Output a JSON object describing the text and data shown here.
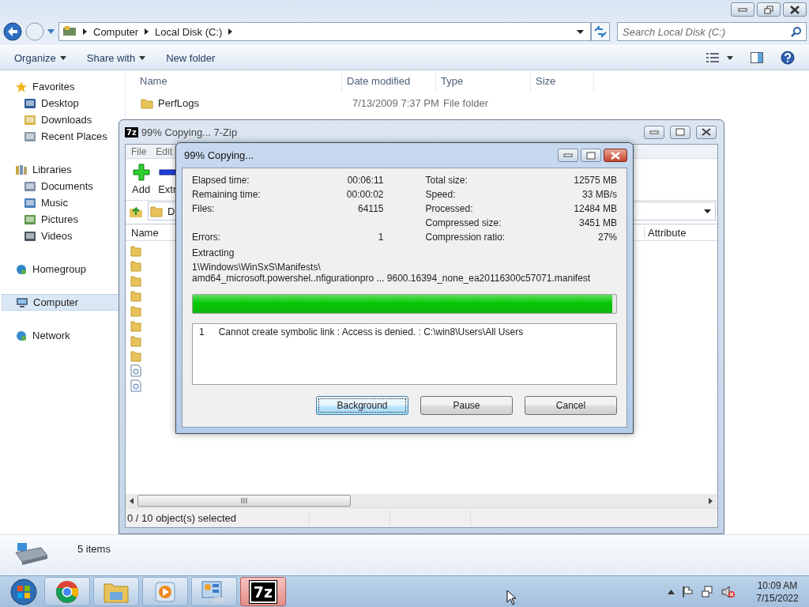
{
  "explorer": {
    "address": [
      "Computer",
      "Local Disk (C:)"
    ],
    "search": {
      "placeholder": "Search Local Disk (C:)"
    },
    "toolbar": [
      {
        "label": "Organize",
        "dropdown": true
      },
      {
        "label": "Share with",
        "dropdown": true
      },
      {
        "label": "New folder",
        "dropdown": false
      }
    ],
    "sidebar": [
      {
        "label": "Favorites",
        "kind": "star",
        "selected": false,
        "children": [
          {
            "label": "Desktop",
            "kind": "desktop",
            "selected": false
          },
          {
            "label": "Downloads",
            "kind": "downloads",
            "selected": false
          },
          {
            "label": "Recent Places",
            "kind": "recent",
            "selected": false
          }
        ]
      },
      {
        "label": "Libraries",
        "kind": "libraries",
        "selected": false,
        "children": [
          {
            "label": "Documents",
            "kind": "documents",
            "selected": false
          },
          {
            "label": "Music",
            "kind": "music",
            "selected": false
          },
          {
            "label": "Pictures",
            "kind": "pictures",
            "selected": false
          },
          {
            "label": "Videos",
            "kind": "videos",
            "selected": false
          }
        ]
      },
      {
        "label": "Homegroup",
        "kind": "homegroup",
        "selected": false
      },
      {
        "label": "Computer",
        "kind": "computer",
        "selected": true
      },
      {
        "label": "Network",
        "kind": "network",
        "selected": false
      }
    ],
    "columns": [
      "Name",
      "Date modified",
      "Type",
      "Size"
    ],
    "rows": [
      {
        "name": "PerfLogs",
        "date": "7/13/2009 7:37 PM",
        "type": "File folder"
      }
    ],
    "details": "5 items"
  },
  "zip_window": {
    "logo": "7z",
    "title": "99% Copying... 7-Zip",
    "menu": [
      "File",
      "Edit"
    ],
    "toolbar": [
      {
        "label": "Add",
        "kind": "add"
      },
      {
        "label": "Extr",
        "kind": "extract"
      }
    ],
    "path": "D",
    "columns": [
      "Name",
      "Attribute"
    ],
    "rows": [
      {
        "kind": "folder"
      },
      {
        "kind": "folder"
      },
      {
        "kind": "folder"
      },
      {
        "kind": "folder"
      },
      {
        "kind": "folder"
      },
      {
        "kind": "folder"
      },
      {
        "kind": "folder"
      },
      {
        "kind": "folder"
      },
      {
        "kind": "file"
      },
      {
        "kind": "file"
      }
    ],
    "status": "0 / 10 object(s) selected"
  },
  "dialog": {
    "title": "99% Copying...",
    "stats": [
      {
        "left": {
          "label": "Elapsed time:",
          "value": "00:06:11"
        },
        "right": {
          "label": "Total size:",
          "value": "12575 MB"
        }
      },
      {
        "left": {
          "label": "Remaining time:",
          "value": "00:00:02"
        },
        "right": {
          "label": "Speed:",
          "value": "33 MB/s"
        }
      },
      {
        "left": {
          "label": "Files:",
          "value": "64115"
        },
        "right": {
          "label": "Processed:",
          "value": "12484 MB"
        }
      },
      {
        "right": {
          "label": "Compressed size:",
          "value": "3451 MB"
        }
      },
      {
        "left": {
          "label": "Errors:",
          "value": "1"
        },
        "right": {
          "label": "Compression ratio:",
          "value": "27%"
        }
      }
    ],
    "operation": "Extracting",
    "path_lines": [
      "1\\Windows\\WinSxS\\Manifests\\",
      "amd64_microsoft.powershel..nfigurationpro ... 9600.16394_none_ea20116300c57071.manifest"
    ],
    "level": 0.99,
    "log": [
      {
        "index": "1",
        "message": "Cannot create symbolic link : Access is denied. : C:\\win8\\Users\\All Users"
      }
    ],
    "buttons": [
      {
        "label": "Background",
        "focused": true
      },
      {
        "label": "Pause",
        "focused": false
      },
      {
        "label": "Cancel",
        "focused": false
      }
    ]
  },
  "taskbar": {
    "apps": [
      {
        "kind": "chrome",
        "selected": false
      },
      {
        "kind": "explorer",
        "selected": false
      },
      {
        "kind": "media",
        "selected": false
      },
      {
        "kind": "control",
        "selected": false
      },
      {
        "kind": "sevenzip",
        "label": "7z",
        "selected": true
      }
    ],
    "time": "10:09 AM",
    "date": "7/15/2022"
  }
}
